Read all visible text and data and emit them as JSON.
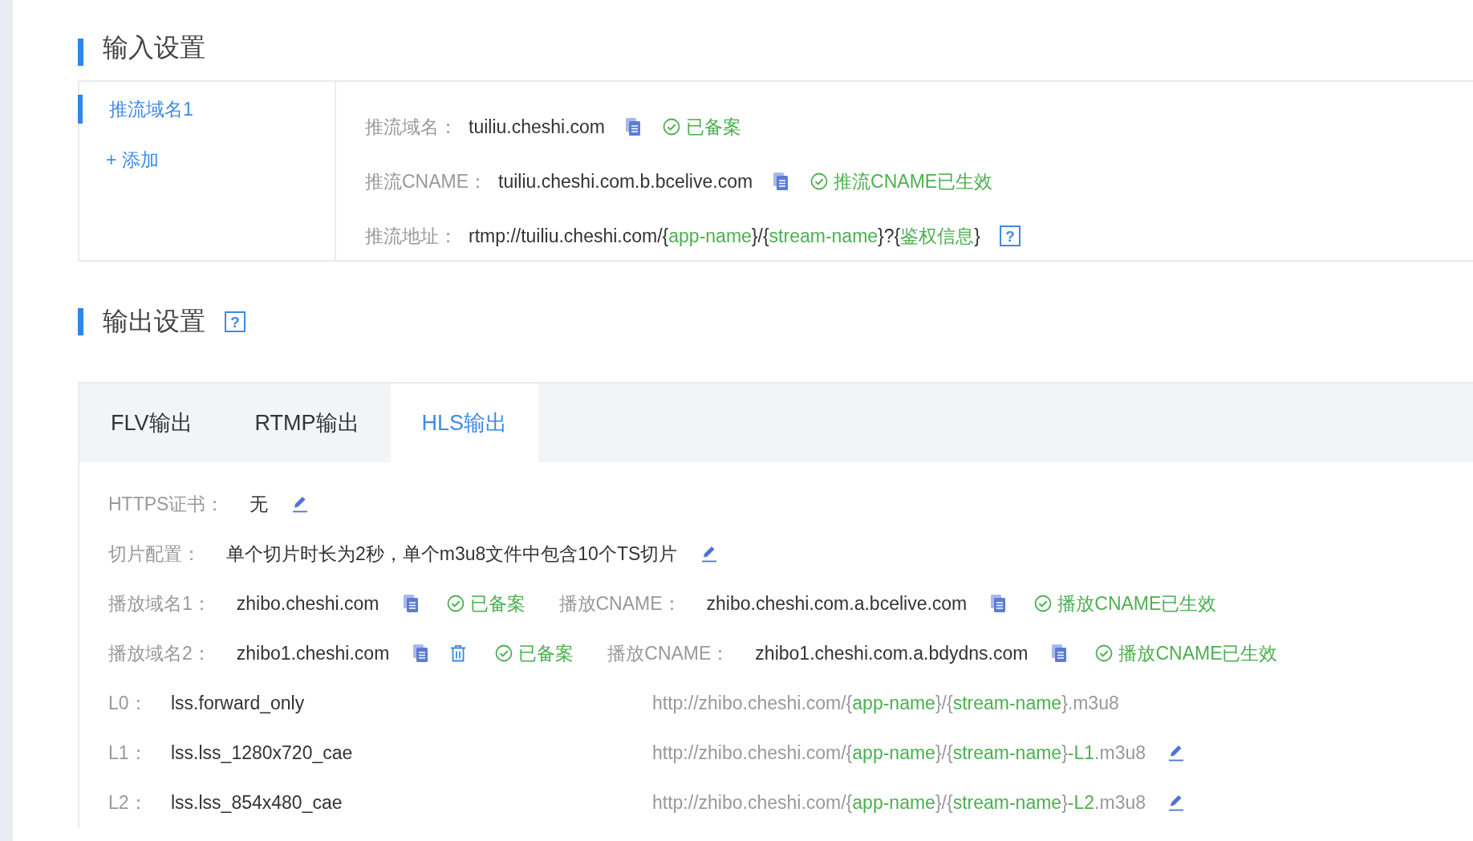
{
  "input_settings": {
    "title": "输入设置",
    "domains": [
      {
        "label": "推流域名1",
        "selected": true
      }
    ],
    "add_button": "+ 添加",
    "fields": [
      {
        "label": "推流域名：",
        "value": [
          {
            "text": "tuiliu.cheshi.com",
            "kind": "plain"
          }
        ],
        "copy": true,
        "status": "已备案"
      },
      {
        "label": "推流CNAME：",
        "value": [
          {
            "text": "tuiliu.cheshi.com.b.bcelive.com",
            "kind": "plain"
          }
        ],
        "copy": true,
        "status": "推流CNAME已生效"
      },
      {
        "label": "推流地址：",
        "value": [
          {
            "text": "rtmp://tuiliu.cheshi.com/{",
            "kind": "plain"
          },
          {
            "text": "app-name",
            "kind": "var"
          },
          {
            "text": "}/{",
            "kind": "plain"
          },
          {
            "text": "stream-name",
            "kind": "var"
          },
          {
            "text": "}?{",
            "kind": "plain"
          },
          {
            "text": "鉴权信息",
            "kind": "var"
          },
          {
            "text": "}",
            "kind": "plain"
          }
        ],
        "copy": false,
        "help": "?"
      }
    ]
  },
  "output_settings": {
    "title": "输出设置",
    "help": "?",
    "tabs": [
      {
        "label": "FLV输出",
        "selected": false
      },
      {
        "label": "RTMP输出",
        "selected": false
      },
      {
        "label": "HLS输出",
        "selected": true
      }
    ],
    "settings": [
      {
        "label": "HTTPS证书：",
        "value": "无",
        "edit": true
      },
      {
        "label": "切片配置：",
        "value": "单个切片时长为2秒，单个m3u8文件中包含10个TS切片",
        "edit": true
      }
    ],
    "play_domains": [
      {
        "label": "播放域名1：",
        "value": "zhibo.cheshi.com",
        "copy": true,
        "delete": false,
        "status": "已备案",
        "cname_label": "播放CNAME：",
        "cname": "zhibo.cheshi.com.a.bcelive.com",
        "cname_copy": true,
        "cname_status": "播放CNAME已生效"
      },
      {
        "label": "播放域名2：",
        "value": "zhibo1.cheshi.com",
        "copy": true,
        "delete": true,
        "status": "已备案",
        "cname_label": "播放CNAME：",
        "cname": "zhibo1.cheshi.com.a.bdydns.com",
        "cname_copy": true,
        "cname_status": "播放CNAME已生效"
      }
    ],
    "levels": [
      {
        "label": "L0：",
        "template": "lss.forward_only",
        "url": [
          {
            "text": "http://zhibo.cheshi.com/{",
            "kind": "plain"
          },
          {
            "text": "app-name",
            "kind": "var"
          },
          {
            "text": "}/{",
            "kind": "plain"
          },
          {
            "text": "stream-name",
            "kind": "var"
          },
          {
            "text": "}.m3u8",
            "kind": "plain"
          }
        ],
        "edit": false
      },
      {
        "label": "L1：",
        "template": "lss.lss_1280x720_cae",
        "url": [
          {
            "text": "http://zhibo.cheshi.com/{",
            "kind": "plain"
          },
          {
            "text": "app-name",
            "kind": "var"
          },
          {
            "text": "}/{",
            "kind": "plain"
          },
          {
            "text": "stream-name",
            "kind": "var"
          },
          {
            "text": "}",
            "kind": "plain"
          },
          {
            "text": "-L1",
            "kind": "var"
          },
          {
            "text": ".m3u8",
            "kind": "plain"
          }
        ],
        "edit": true
      },
      {
        "label": "L2：",
        "template": "lss.lss_854x480_cae",
        "url": [
          {
            "text": "http://zhibo.cheshi.com/{",
            "kind": "plain"
          },
          {
            "text": "app-name",
            "kind": "var"
          },
          {
            "text": "}/{",
            "kind": "plain"
          },
          {
            "text": "stream-name",
            "kind": "var"
          },
          {
            "text": "}",
            "kind": "plain"
          },
          {
            "text": "-L2",
            "kind": "var"
          },
          {
            "text": ".m3u8",
            "kind": "plain"
          }
        ],
        "edit": true
      }
    ]
  }
}
